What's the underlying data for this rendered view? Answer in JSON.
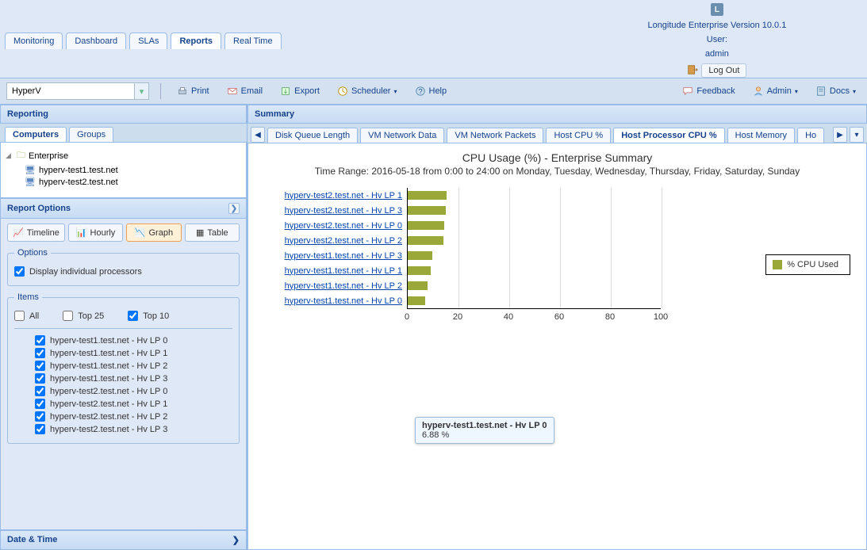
{
  "app": {
    "version_label": "Longitude Enterprise Version 10.0.1",
    "user_prefix": "User:",
    "user": "admin",
    "logout": "Log Out"
  },
  "nav_tabs": [
    "Monitoring",
    "Dashboard",
    "SLAs",
    "Reports",
    "Real Time"
  ],
  "nav_active": 3,
  "toolbar": {
    "dropdown_value": "HyperV",
    "print": "Print",
    "email": "Email",
    "export": "Export",
    "scheduler": "Scheduler",
    "help": "Help",
    "feedback": "Feedback",
    "admin": "Admin",
    "docs": "Docs"
  },
  "left": {
    "reporting": "Reporting",
    "sub_tabs": [
      "Computers",
      "Groups"
    ],
    "sub_active": 0,
    "tree": {
      "root": "Enterprise",
      "children": [
        "hyperv-test1.test.net",
        "hyperv-test2.test.net"
      ]
    },
    "report_options": "Report Options",
    "view_buttons": [
      "Timeline",
      "Hourly",
      "Graph",
      "Table"
    ],
    "view_selected": 2,
    "options_legend": "Options",
    "display_individual": "Display individual processors",
    "items_legend": "Items",
    "filters": [
      "All",
      "Top 25",
      "Top 10"
    ],
    "filter_selected": 2,
    "items": [
      "hyperv-test1.test.net - Hv LP 0",
      "hyperv-test1.test.net - Hv LP 1",
      "hyperv-test1.test.net - Hv LP 2",
      "hyperv-test1.test.net - Hv LP 3",
      "hyperv-test2.test.net - Hv LP 0",
      "hyperv-test2.test.net - Hv LP 1",
      "hyperv-test2.test.net - Hv LP 2",
      "hyperv-test2.test.net - Hv LP 3"
    ],
    "datetime": "Date & Time"
  },
  "summary": {
    "title": "Summary",
    "tabs": [
      "Disk Queue Length",
      "VM Network Data",
      "VM Network Packets",
      "Host CPU %",
      "Host Processor CPU %",
      "Host Memory",
      "Ho"
    ],
    "tabs_active": 4
  },
  "chart_data": {
    "type": "bar",
    "orientation": "horizontal",
    "title": "CPU Usage (%) - Enterprise Summary",
    "subtitle": "Time Range: 2016-05-18 from 0:00 to 24:00 on Monday, Tuesday, Wednesday, Thursday, Friday, Saturday, Sunday",
    "xlabel": "",
    "ylabel": "",
    "xlim": [
      0,
      100
    ],
    "xticks": [
      0,
      20,
      40,
      60,
      80,
      100
    ],
    "categories": [
      "hyperv-test2.test.net - Hv LP 1",
      "hyperv-test2.test.net - Hv LP 3",
      "hyperv-test2.test.net - Hv LP 0",
      "hyperv-test2.test.net - Hv LP 2",
      "hyperv-test1.test.net - Hv LP 3",
      "hyperv-test1.test.net - Hv LP 1",
      "hyperv-test1.test.net - Hv LP 2",
      "hyperv-test1.test.net - Hv LP 0"
    ],
    "series": [
      {
        "name": "% CPU Used",
        "values": [
          15.3,
          15.0,
          14.3,
          14.0,
          9.7,
          9.2,
          7.8,
          6.88
        ]
      }
    ],
    "legend": [
      "% CPU Used"
    ],
    "tooltip": {
      "label": "hyperv-test1.test.net - Hv LP 0",
      "value": "6.88 %"
    }
  }
}
